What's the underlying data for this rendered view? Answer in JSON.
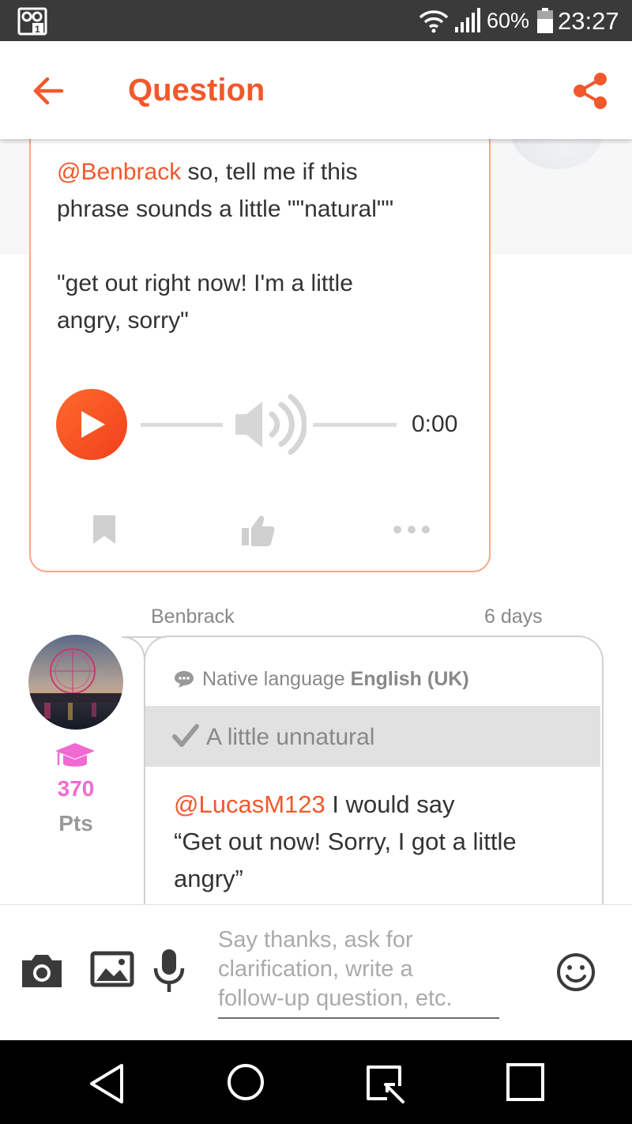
{
  "status_bar": {
    "battery": "60%",
    "time": "23:27"
  },
  "app_bar": {
    "title": "Question"
  },
  "question": {
    "mention": "@Benbrack",
    "line1_rest": " so, tell me if this",
    "line2": "phrase sounds a little \"\"natural\"\"",
    "line3": "\"get out right now! I'm a little",
    "line4": "angry, sorry\"",
    "audio_duration": "0:00"
  },
  "answer": {
    "author": "Benbrack",
    "time_ago": "6 days",
    "points": "370",
    "points_label": "Pts",
    "native_label": "Native language",
    "native_value": "English (UK)",
    "verdict": "A little unnatural",
    "mention": "@LucasM123",
    "line1_rest": " I would say",
    "line2": "“Get out now! Sorry, I got a little",
    "line3": "angry”"
  },
  "composer": {
    "line1": "Say thanks, ask for",
    "line2": "clarification, write a",
    "line3": "follow-up question, etc."
  },
  "colors": {
    "accent": "#f2582b",
    "points": "#f06ad2",
    "card_border": "#f6a88a"
  }
}
